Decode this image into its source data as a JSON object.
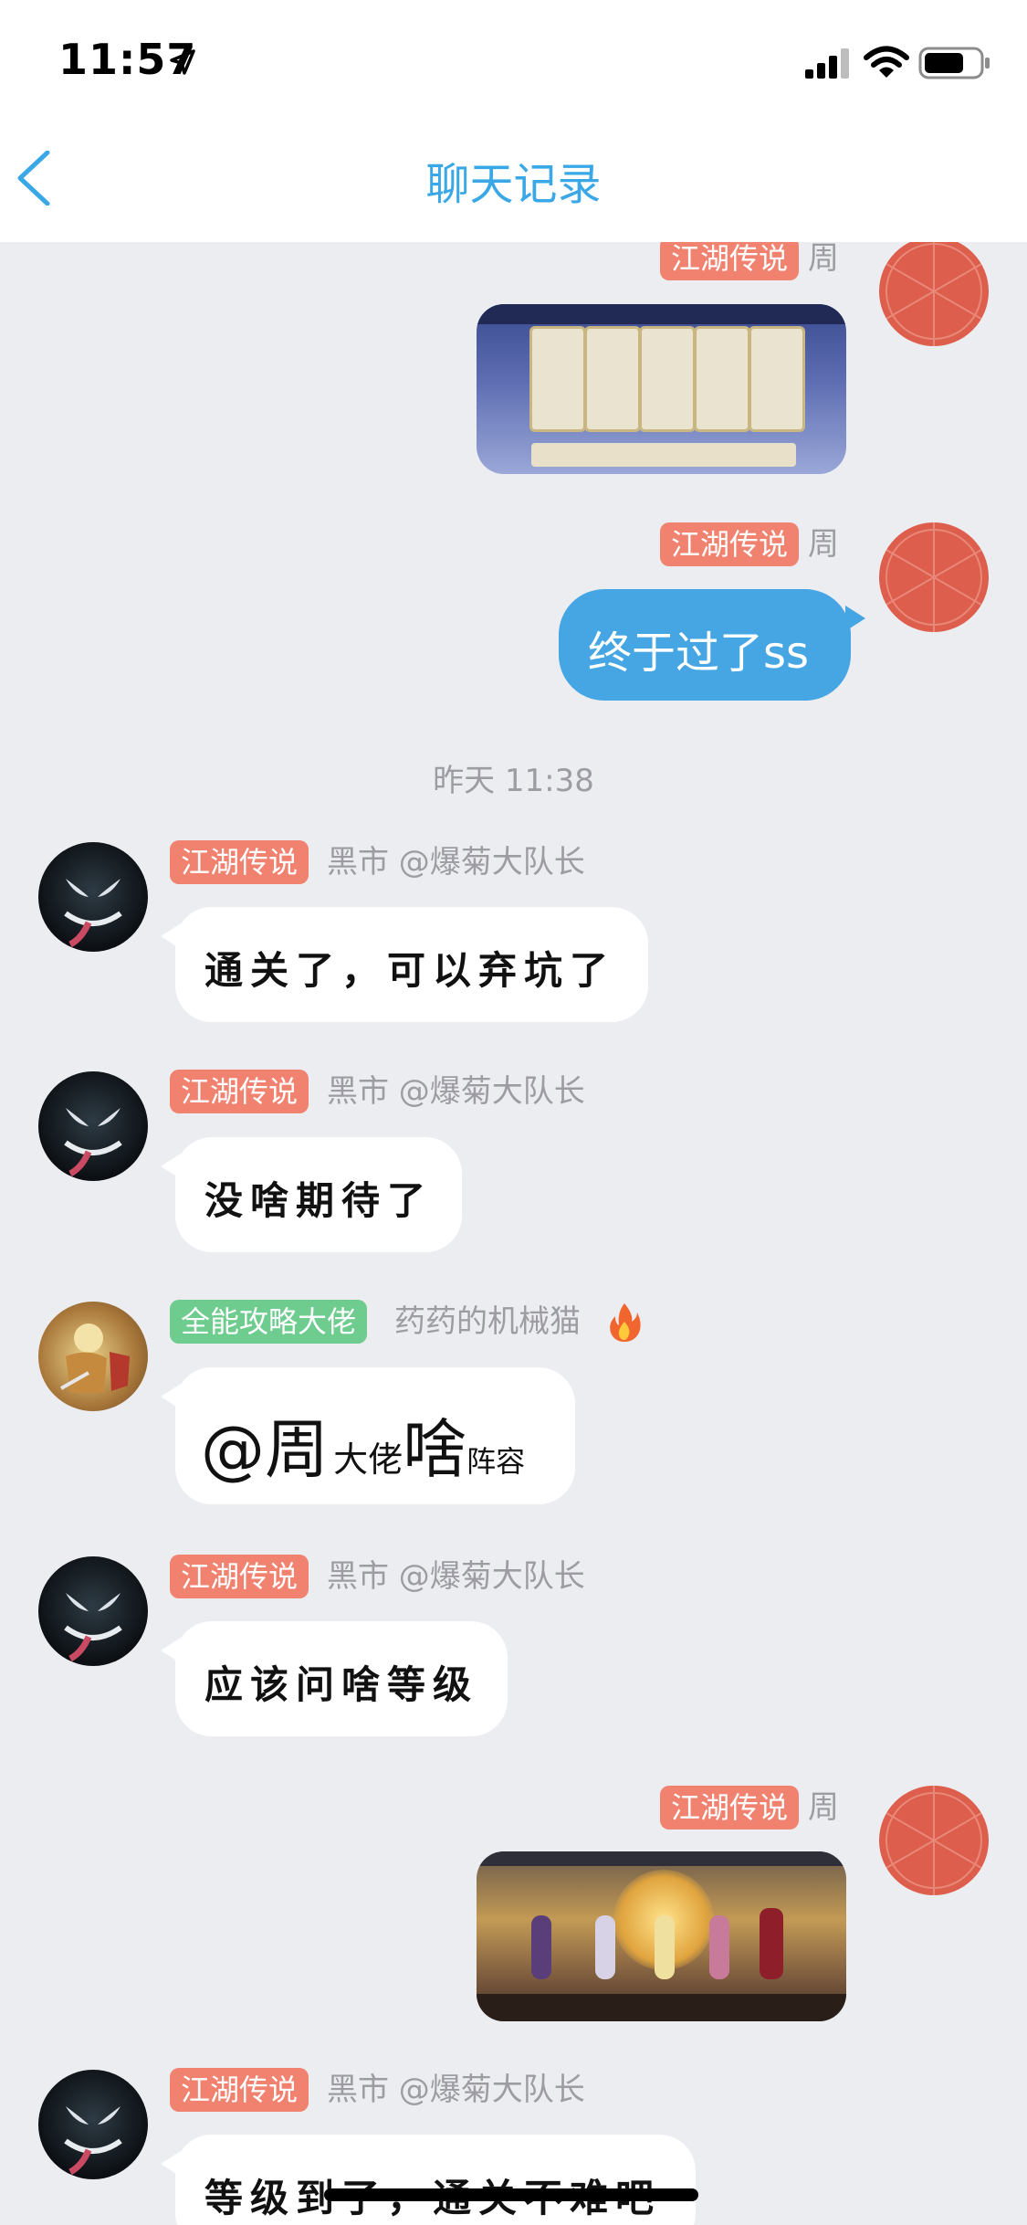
{
  "status_bar": {
    "time": "11:57"
  },
  "header": {
    "title": "聊天记录"
  },
  "messages": [
    {
      "badge": "江湖传说",
      "sender": "周",
      "type": "image"
    },
    {
      "badge": "江湖传说",
      "sender": "周",
      "text": "终于过了ss"
    },
    {
      "timestamp": "昨天 11:38"
    },
    {
      "badge": "江湖传说",
      "sender": "黑市 @爆菊大队长",
      "text": "通关了，可以弃坑了"
    },
    {
      "badge": "江湖传说",
      "sender": "黑市 @爆菊大队长",
      "text": "没啥期待了"
    },
    {
      "badge": "全能攻略大佬",
      "sender": "药药的机械猫",
      "text_parts": [
        "@周",
        "大佬",
        "啥",
        "阵容"
      ]
    },
    {
      "badge": "江湖传说",
      "sender": "黑市 @爆菊大队长",
      "text": "应该问啥等级"
    },
    {
      "badge": "江湖传说",
      "sender": "周",
      "type": "image"
    },
    {
      "badge": "江湖传说",
      "sender": "黑市 @爆菊大队长",
      "text": "等级到了，通关不难吧"
    }
  ],
  "colors": {
    "accent": "#3AA8E6",
    "outgoing_bubble": "#45A6E3",
    "badge_red": "#F0826F",
    "badge_green": "#6FCC8F",
    "chat_background": "#ECEDF1"
  }
}
